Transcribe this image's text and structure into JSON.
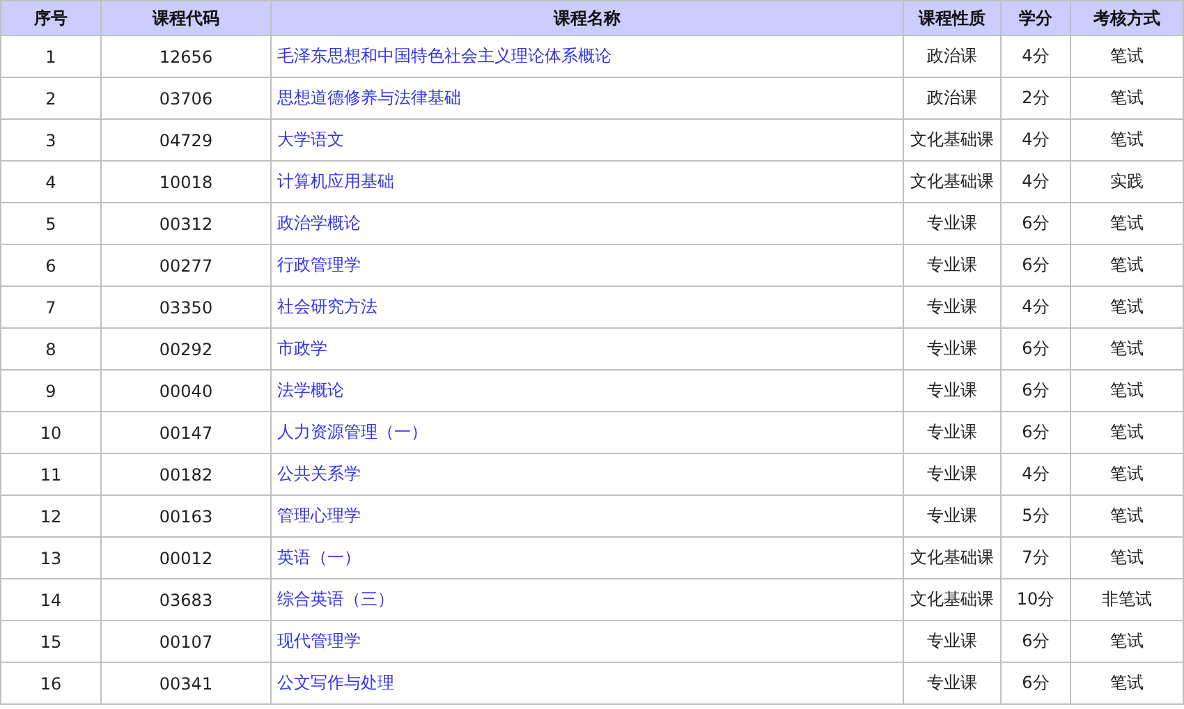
{
  "table": {
    "columns": [
      "序号",
      "课程代码",
      "课程名称",
      "课程性质",
      "学分",
      "考核方式"
    ],
    "rows": [
      [
        "1",
        "12656",
        "毛泽东思想和中国特色社会主义理论体系概论",
        "政治课",
        "4分",
        "笔试"
      ],
      [
        "2",
        "03706",
        "思想道德修养与法律基础",
        "政治课",
        "2分",
        "笔试"
      ],
      [
        "3",
        "04729",
        "大学语文",
        "文化基础课",
        "4分",
        "笔试"
      ],
      [
        "4",
        "10018",
        "计算机应用基础",
        "文化基础课",
        "4分",
        "实践"
      ],
      [
        "5",
        "00312",
        "政治学概论",
        "专业课",
        "6分",
        "笔试"
      ],
      [
        "6",
        "00277",
        "行政管理学",
        "专业课",
        "6分",
        "笔试"
      ],
      [
        "7",
        "03350",
        "社会研究方法",
        "专业课",
        "4分",
        "笔试"
      ],
      [
        "8",
        "00292",
        "市政学",
        "专业课",
        "6分",
        "笔试"
      ],
      [
        "9",
        "00040",
        "法学概论",
        "专业课",
        "6分",
        "笔试"
      ],
      [
        "10",
        "00147",
        "人力资源管理（一）",
        "专业课",
        "6分",
        "笔试"
      ],
      [
        "11",
        "00182",
        "公共关系学",
        "专业课",
        "4分",
        "笔试"
      ],
      [
        "12",
        "00163",
        "管理心理学",
        "专业课",
        "5分",
        "笔试"
      ],
      [
        "13",
        "00012",
        "英语（一）",
        "文化基础课",
        "7分",
        "笔试"
      ],
      [
        "14",
        "03683",
        "综合英语（三）",
        "文化基础课",
        "10分",
        "非笔试"
      ],
      [
        "15",
        "00107",
        "现代管理学",
        "专业课",
        "6分",
        "笔试"
      ],
      [
        "16",
        "00341",
        "公文写作与处理",
        "专业课",
        "6分",
        "笔试"
      ]
    ]
  }
}
